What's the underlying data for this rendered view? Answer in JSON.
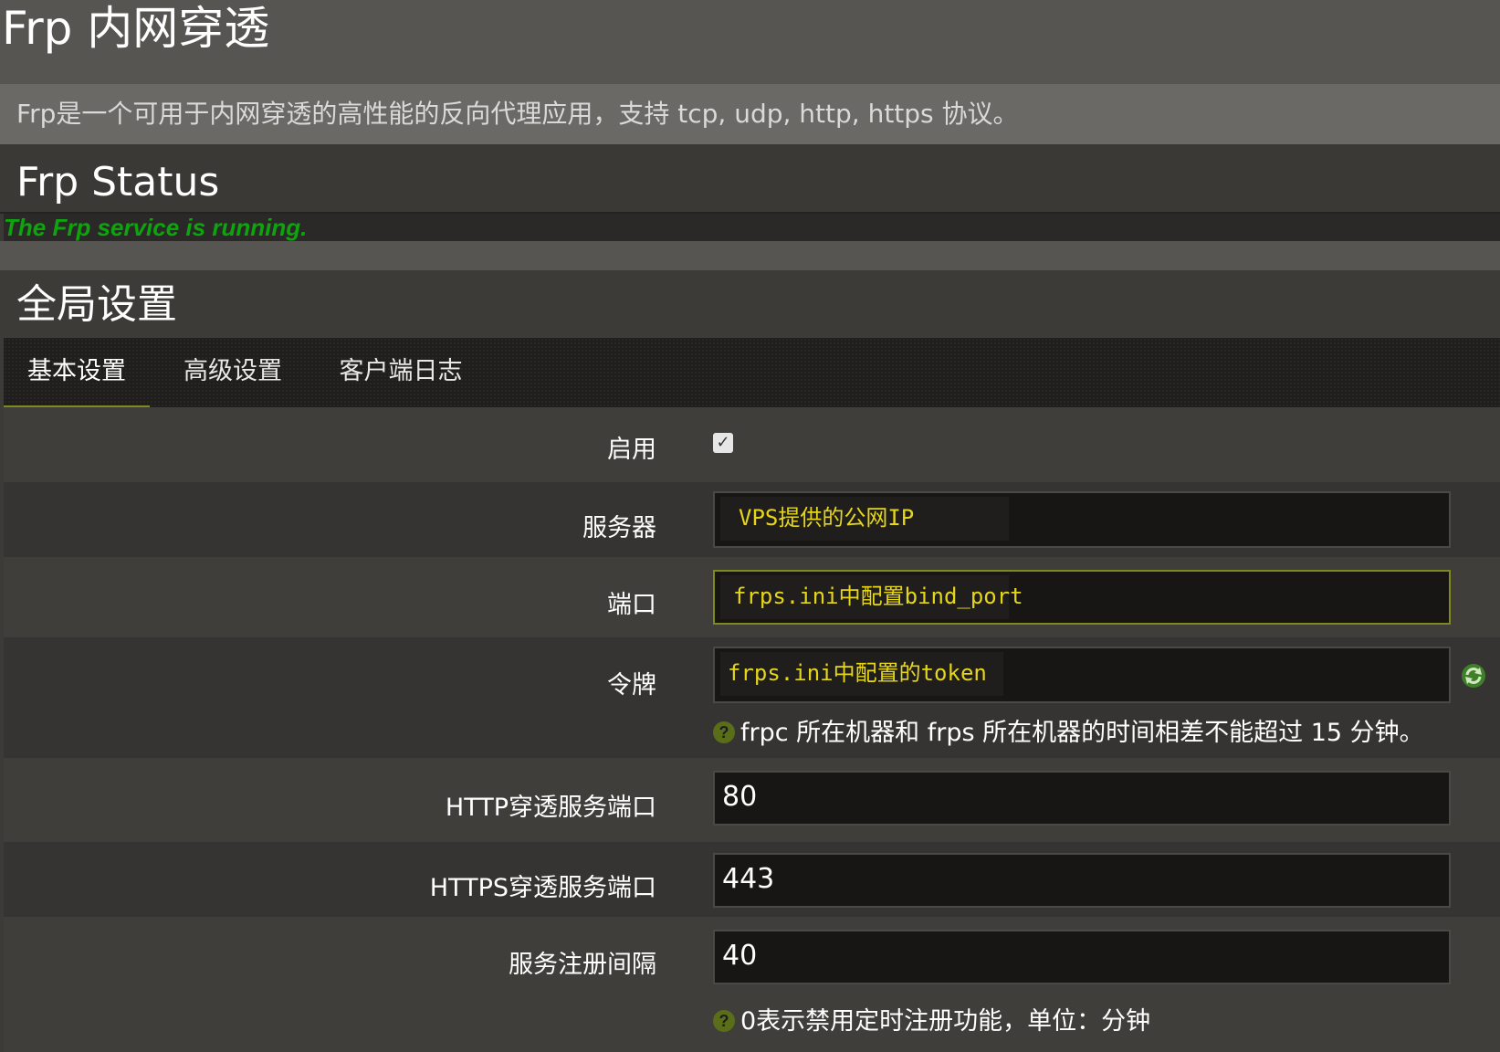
{
  "page": {
    "title": "Frp 内网穿透",
    "description": "Frp是一个可用于内网穿透的高性能的反向代理应用，支持 tcp, udp, http, https 协议。"
  },
  "status": {
    "title": "Frp Status",
    "message": "The Frp service is running.",
    "message_color": "#0da40d"
  },
  "global": {
    "title": "全局设置",
    "tabs": [
      {
        "label": "基本设置",
        "active": true
      },
      {
        "label": "高级设置",
        "active": false
      },
      {
        "label": "客户端日志",
        "active": false
      }
    ],
    "fields": {
      "enable": {
        "label": "启用",
        "checked": true
      },
      "server": {
        "label": "服务器",
        "value": "",
        "placeholder": "VPS提供的公网IP"
      },
      "port": {
        "label": "端口",
        "value": "",
        "placeholder": "frps.ini中配置bind_port"
      },
      "token": {
        "label": "令牌",
        "value": "",
        "placeholder": "frps.ini中配置的token",
        "icon": "refresh-icon",
        "help": "frpc 所在机器和 frps 所在机器的时间相差不能超过 15 分钟。"
      },
      "http_port": {
        "label": "HTTP穿透服务端口",
        "value": "80"
      },
      "https_port": {
        "label": "HTTPS穿透服务端口",
        "value": "443"
      },
      "register_interval": {
        "label": "服务注册间隔",
        "value": "40",
        "help": "0表示禁用定时注册功能，单位：分钟"
      }
    }
  },
  "colors": {
    "accent": "#7c8a1e",
    "placeholder": "#e6d619"
  }
}
